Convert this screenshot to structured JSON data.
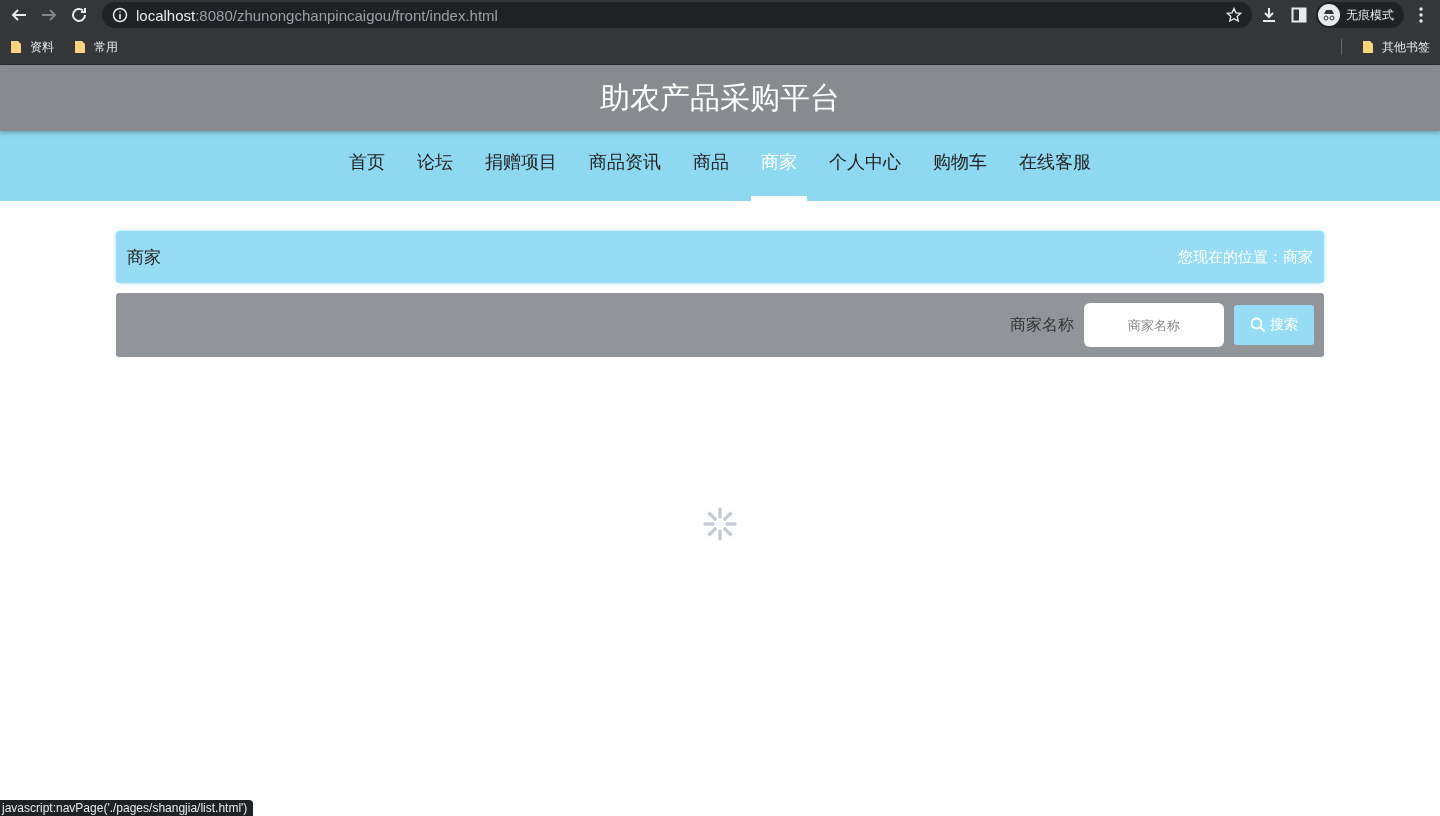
{
  "browser": {
    "url_host": "localhost",
    "url_path": ":8080/zhunongchanpincaigou/front/index.html",
    "profile_label": "无痕模式",
    "bookmarks": [
      {
        "label": "资料"
      },
      {
        "label": "常用"
      }
    ],
    "other_bookmarks": "其他书签"
  },
  "site": {
    "title": "助农产品采购平台",
    "nav": [
      {
        "label": "首页",
        "selected": false
      },
      {
        "label": "论坛",
        "selected": false
      },
      {
        "label": "捐赠项目",
        "selected": false
      },
      {
        "label": "商品资讯",
        "selected": false
      },
      {
        "label": "商品",
        "selected": false
      },
      {
        "label": "商家",
        "selected": true
      },
      {
        "label": "个人中心",
        "selected": false
      },
      {
        "label": "购物车",
        "selected": false
      },
      {
        "label": "在线客服",
        "selected": false
      }
    ],
    "page_heading": "商家",
    "breadcrumb": "您现在的位置：商家",
    "search": {
      "label": "商家名称",
      "placeholder": "商家名称",
      "button": "搜索"
    }
  },
  "status_link": "javascript:navPage('./pages/shangjia/list.html')"
}
